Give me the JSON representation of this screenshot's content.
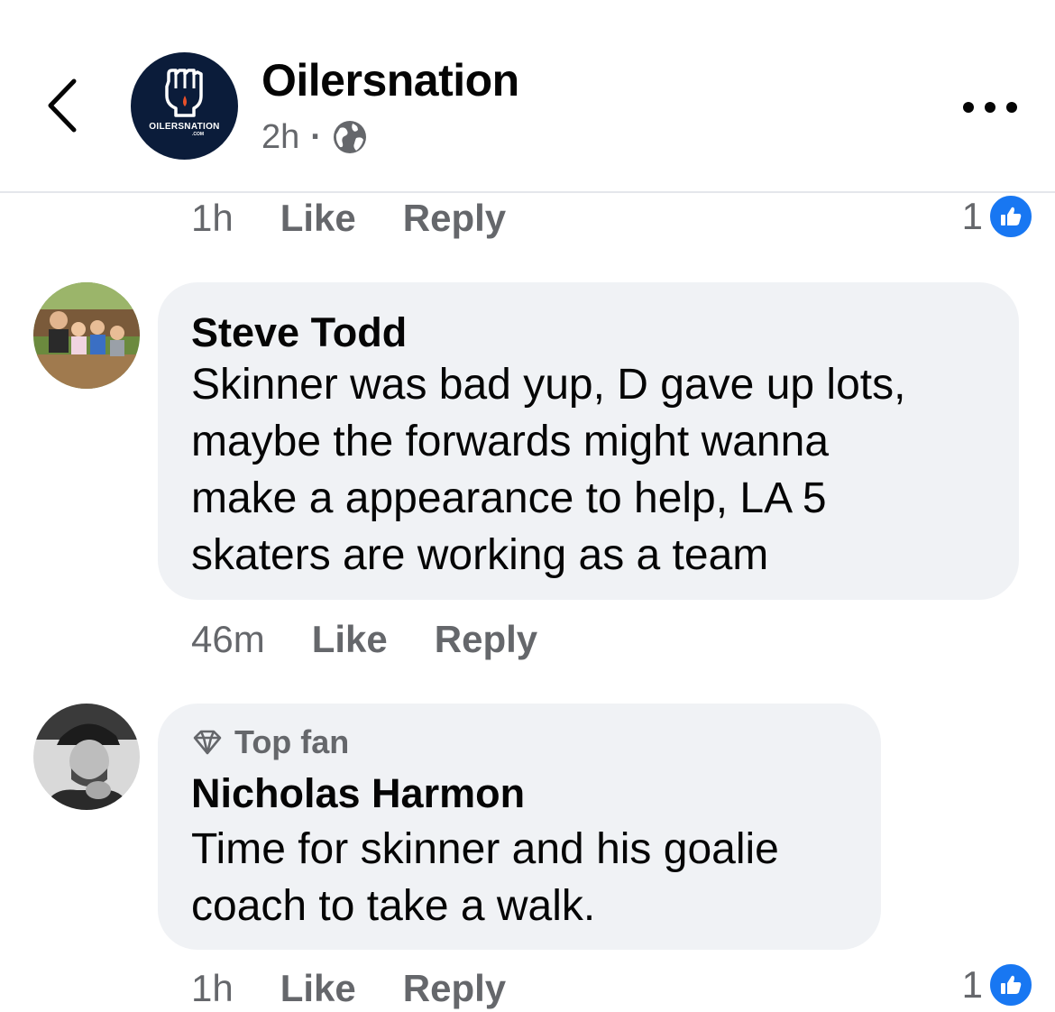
{
  "header": {
    "back_icon": "chevron-left-icon",
    "page_name": "Oilersnation",
    "avatar_text": "OILERSNATION",
    "avatar_subtext": ".COM",
    "post_time": "2h",
    "separator": "·",
    "audience_icon": "globe-icon",
    "more_icon": "more-dots-icon"
  },
  "comments": [
    {
      "time": "1h",
      "like_label": "Like",
      "reply_label": "Reply",
      "reaction_count": "1",
      "reaction_icon": "thumbs-up-icon"
    },
    {
      "author": "Steve Todd",
      "text_lines": [
        "Skinner was bad yup, D gave up lots,",
        "maybe the forwards might wanna",
        "make a appearance to help, LA 5",
        "skaters are working as a team"
      ],
      "time": "46m",
      "like_label": "Like",
      "reply_label": "Reply"
    },
    {
      "badge": "Top fan",
      "badge_icon": "diamond-icon",
      "author": "Nicholas Harmon",
      "text_lines": [
        "Time for skinner and his goalie",
        "coach to take a walk."
      ],
      "time": "1h",
      "like_label": "Like",
      "reply_label": "Reply",
      "reaction_count": "1",
      "reaction_icon": "thumbs-up-icon"
    }
  ],
  "colors": {
    "bubble": "#f0f2f5",
    "secondary_text": "#65676b",
    "like_blue": "#1877f2",
    "page_avatar_bg": "#0b1c3a",
    "logo_drop": "#e8502a"
  }
}
